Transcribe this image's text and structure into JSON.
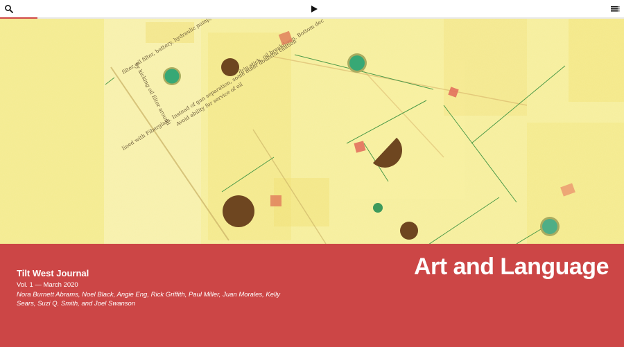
{
  "toolbar": {
    "search_icon": "search-icon",
    "play_icon": "play-icon",
    "menu_icon": "list-menu-icon",
    "progress_fraction": 0.06,
    "accent": "#d04848"
  },
  "hero": {
    "art_text": {
      "line1": "filter, oil filter, battery, hydraulic pump,",
      "line2": "drip stick, oil breakdown. Bottom dec",
      "line3": "Avoid ability for service of oil",
      "line4": "by kicking oil filter around",
      "line5": "lined with Fiberglass. Instead of gun separation, some other doubtful caution"
    },
    "palette": {
      "background": "#f6ee9c",
      "dot_brown": "#7a4a1f",
      "dot_green": "#3aa873",
      "square_red": "#e0725a"
    }
  },
  "banner": {
    "color": "#cc4646",
    "journal_title": "Tilt West Journal",
    "issue": "Vol. 1 — March 2020",
    "authors": "Nora Burnett Abrams, Noel Black, Angie Eng, Rick Griffith, Paul Miller, Juan Morales, Kelly Sears, Suzi Q. Smith, and Joel Swanson",
    "headline": "Art and Language"
  }
}
